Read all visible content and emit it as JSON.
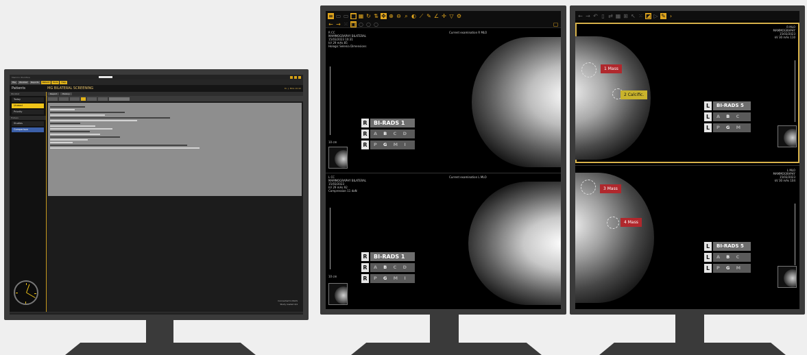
{
  "workflow_monitor": {
    "window_title": "Mammo Workflow",
    "menu": [
      "File",
      "Worklist",
      "Reports",
      "Patient",
      "Tools",
      "Help"
    ],
    "header_left": "Patients",
    "header_title": "MG BILATERAL SCREENING",
    "header_right": "Dr. J. Mills  10:42",
    "sidebar_section_1": "Worklist",
    "sidebar_items": [
      "Today",
      "Unread",
      "Priority"
    ],
    "sidebar_section_2": "Folders",
    "sidebar_folder_items": [
      "Studies",
      "Comparison"
    ],
    "tabs": [
      "Report",
      "History"
    ],
    "status_lines": [
      "Connected to PACS",
      "Study loaded 4/4"
    ]
  },
  "viewer_left": {
    "top_view": {
      "overlay_lines": [
        "R CC",
        "MAMMOGRAPHY BILATERAL",
        "15/03/2023 10:31",
        "kV 29 mAs 85",
        "Hologic Selenia Dimensions"
      ],
      "overlay_right": "Current examination R MLO",
      "scale_label": "10 cm",
      "birads_label": "BI-RADS 1",
      "density": [
        "A",
        "B",
        "C",
        "D"
      ],
      "pgmi": [
        "P",
        "G",
        "M",
        "I"
      ]
    },
    "bottom_view": {
      "overlay_lines": [
        "L CC",
        "MAMMOGRAPHY BILATERAL",
        "15/03/2023",
        "kV 29 mAs 92",
        "Compression 11 daN"
      ],
      "overlay_right": "Current examination L MLO",
      "scale_label": "10 cm",
      "birads_label": "BI-RADS 1",
      "density": [
        "A",
        "B",
        "C",
        "D"
      ],
      "pgmi": [
        "P",
        "G",
        "M",
        "I"
      ]
    }
  },
  "viewer_right": {
    "top_view": {
      "overlay_right": [
        "R MLO",
        "MAMMOGRAPHY",
        "15/03/2023",
        "kV 30 mAs 110"
      ],
      "side_letter": "L",
      "birads_label": "BI-RADS 5",
      "density": [
        "A",
        "B",
        "C",
        "D"
      ],
      "pgmi": [
        "P",
        "G",
        "M"
      ],
      "findings": [
        {
          "label": "1 Mass",
          "color": "#b0282d"
        },
        {
          "label": "2 Calcific.",
          "color": "#c9b32c"
        }
      ]
    },
    "bottom_view": {
      "overlay_right": [
        "L MLO",
        "MAMMOGRAPHY",
        "15/03/2023",
        "kV 30 mAs 104"
      ],
      "side_letter": "L",
      "birads_label": "BI-RADS 5",
      "density": [
        "A",
        "B",
        "C",
        "D"
      ],
      "pgmi": [
        "P",
        "G",
        "M"
      ],
      "findings": [
        {
          "label": "3 Mass",
          "color": "#b0282d"
        },
        {
          "label": "4 Mass",
          "color": "#b0282d"
        }
      ]
    }
  },
  "colors": {
    "accent": "#e0a51e",
    "finding_red": "#b0282d",
    "finding_yellow": "#c9b32c",
    "bezel": "#3a3a3a"
  },
  "icons": [
    "menu-icon",
    "layout-icon",
    "zoom-icon",
    "pan-icon",
    "window-level-icon",
    "measure-icon",
    "annotate-icon",
    "rotate-icon",
    "invert-icon",
    "settings-icon",
    "back-icon",
    "forward-icon"
  ]
}
